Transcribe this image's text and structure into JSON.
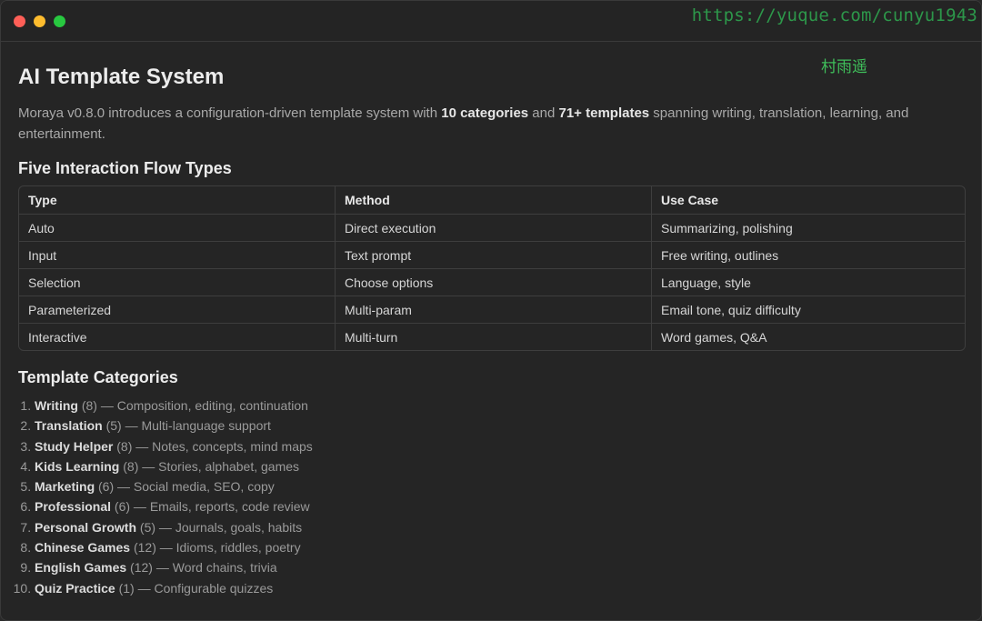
{
  "watermark": {
    "url": "https://yuque.com/cunyu1943",
    "author": "村雨遥"
  },
  "page": {
    "title": "AI Template System",
    "intro": {
      "prefix": "Moraya v0.8.0 introduces a configuration-driven template system with ",
      "bold1": "10 categories",
      "mid": " and ",
      "bold2": "71+ templates",
      "suffix": " spanning writing, translation, learning, and entertainment."
    }
  },
  "flow_section": {
    "heading": "Five Interaction Flow Types",
    "columns": [
      "Type",
      "Method",
      "Use Case"
    ],
    "rows": [
      [
        "Auto",
        "Direct execution",
        "Summarizing, polishing"
      ],
      [
        "Input",
        "Text prompt",
        "Free writing, outlines"
      ],
      [
        "Selection",
        "Choose options",
        "Language, style"
      ],
      [
        "Parameterized",
        "Multi-param",
        "Email tone, quiz difficulty"
      ],
      [
        "Interactive",
        "Multi-turn",
        "Word games, Q&A"
      ]
    ]
  },
  "categories_section": {
    "heading": "Template Categories",
    "items": [
      {
        "name": "Writing",
        "count": "(8)",
        "desc": " — Composition, editing, continuation"
      },
      {
        "name": "Translation",
        "count": "(5)",
        "desc": " — Multi-language support"
      },
      {
        "name": "Study Helper",
        "count": "(8)",
        "desc": " — Notes, concepts, mind maps"
      },
      {
        "name": "Kids Learning",
        "count": "(8)",
        "desc": " — Stories, alphabet, games"
      },
      {
        "name": "Marketing",
        "count": "(6)",
        "desc": " — Social media, SEO, copy"
      },
      {
        "name": "Professional",
        "count": "(6)",
        "desc": " — Emails, reports, code review"
      },
      {
        "name": "Personal Growth",
        "count": "(5)",
        "desc": " — Journals, goals, habits"
      },
      {
        "name": "Chinese Games",
        "count": "(12)",
        "desc": " — Idioms, riddles, poetry"
      },
      {
        "name": "English Games",
        "count": "(12)",
        "desc": " — Word chains, trivia"
      },
      {
        "name": "Quiz Practice",
        "count": "(1)",
        "desc": " — Configurable quizzes"
      }
    ]
  }
}
